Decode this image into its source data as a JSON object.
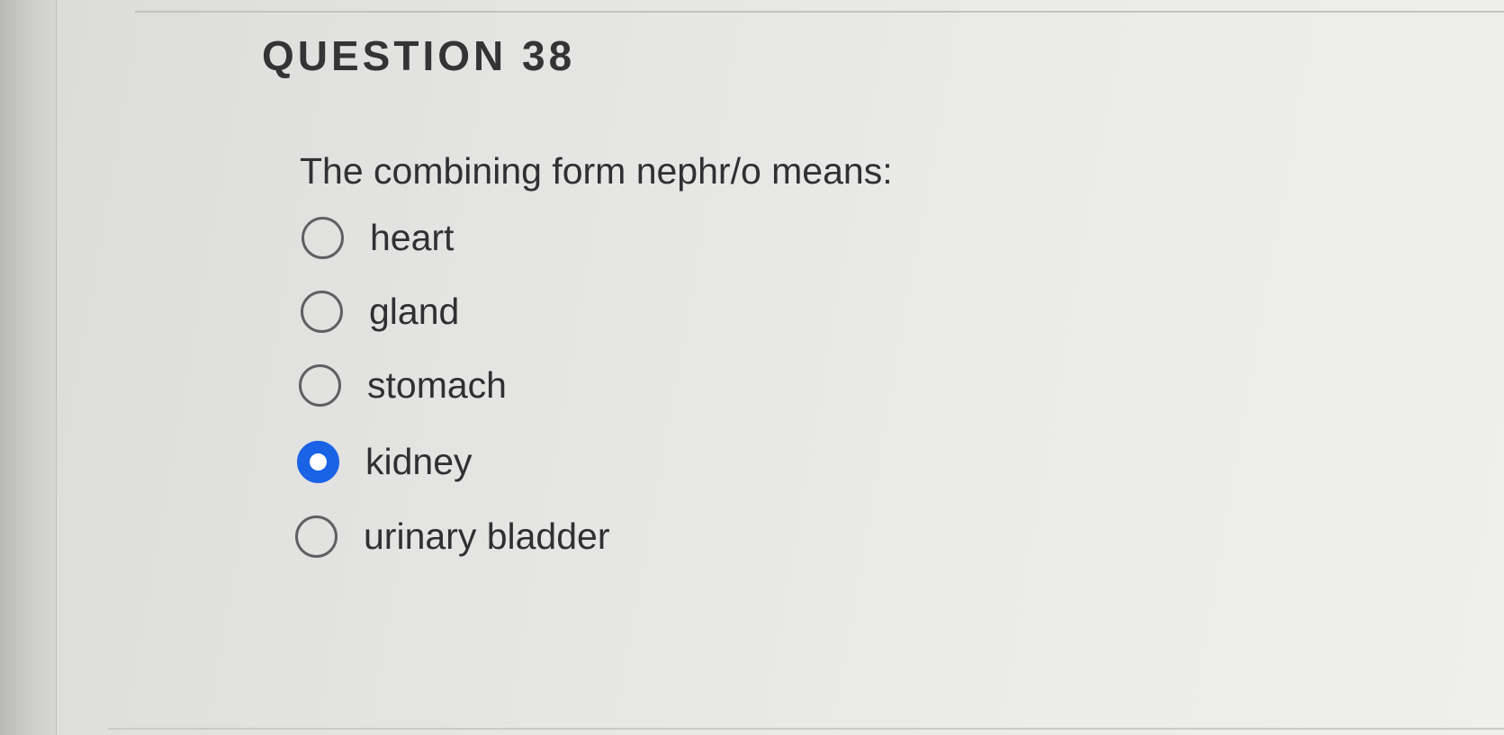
{
  "question": {
    "title": "QUESTION 38",
    "text": "The combining form nephr/o means:"
  },
  "options": [
    {
      "label": "heart",
      "selected": false
    },
    {
      "label": "gland",
      "selected": false
    },
    {
      "label": "stomach",
      "selected": false
    },
    {
      "label": "kidney",
      "selected": true
    },
    {
      "label": "urinary bladder",
      "selected": false
    }
  ],
  "colors": {
    "selected_radio": "#1a62e6",
    "text": "#2f3033",
    "radio_border": "#5f6063"
  }
}
